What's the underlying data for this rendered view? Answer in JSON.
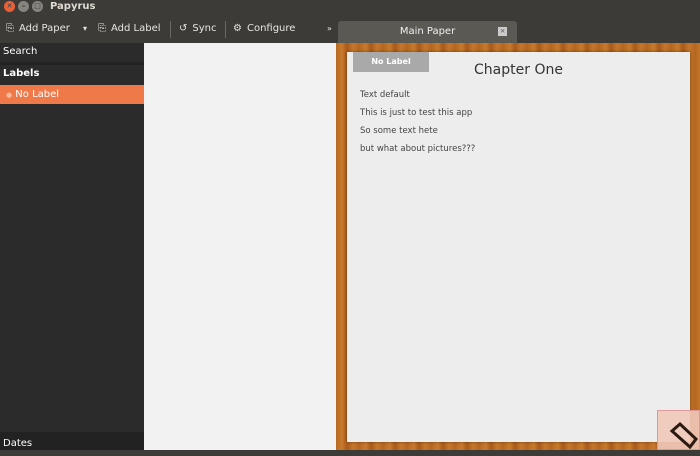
{
  "window": {
    "title": "Papyrus"
  },
  "toolbar": {
    "add_paper": "Add Paper",
    "add_label": "Add Label",
    "sync": "Sync",
    "configure": "Configure",
    "overflow": "»"
  },
  "sidebar": {
    "search": "Search",
    "labels_heading": "Labels",
    "labels": [
      {
        "label": "No Label"
      }
    ],
    "dates": "Dates"
  },
  "tab": {
    "title": "Main Paper",
    "close": "×"
  },
  "paper": {
    "label_button": "No Label",
    "title": "Chapter One",
    "lines": [
      "Text default",
      "This is just to test this app",
      "So some text hete",
      "but what about pictures???"
    ]
  },
  "colors": {
    "accent": "#f0794a",
    "sidebar": "#2b2b2b"
  }
}
